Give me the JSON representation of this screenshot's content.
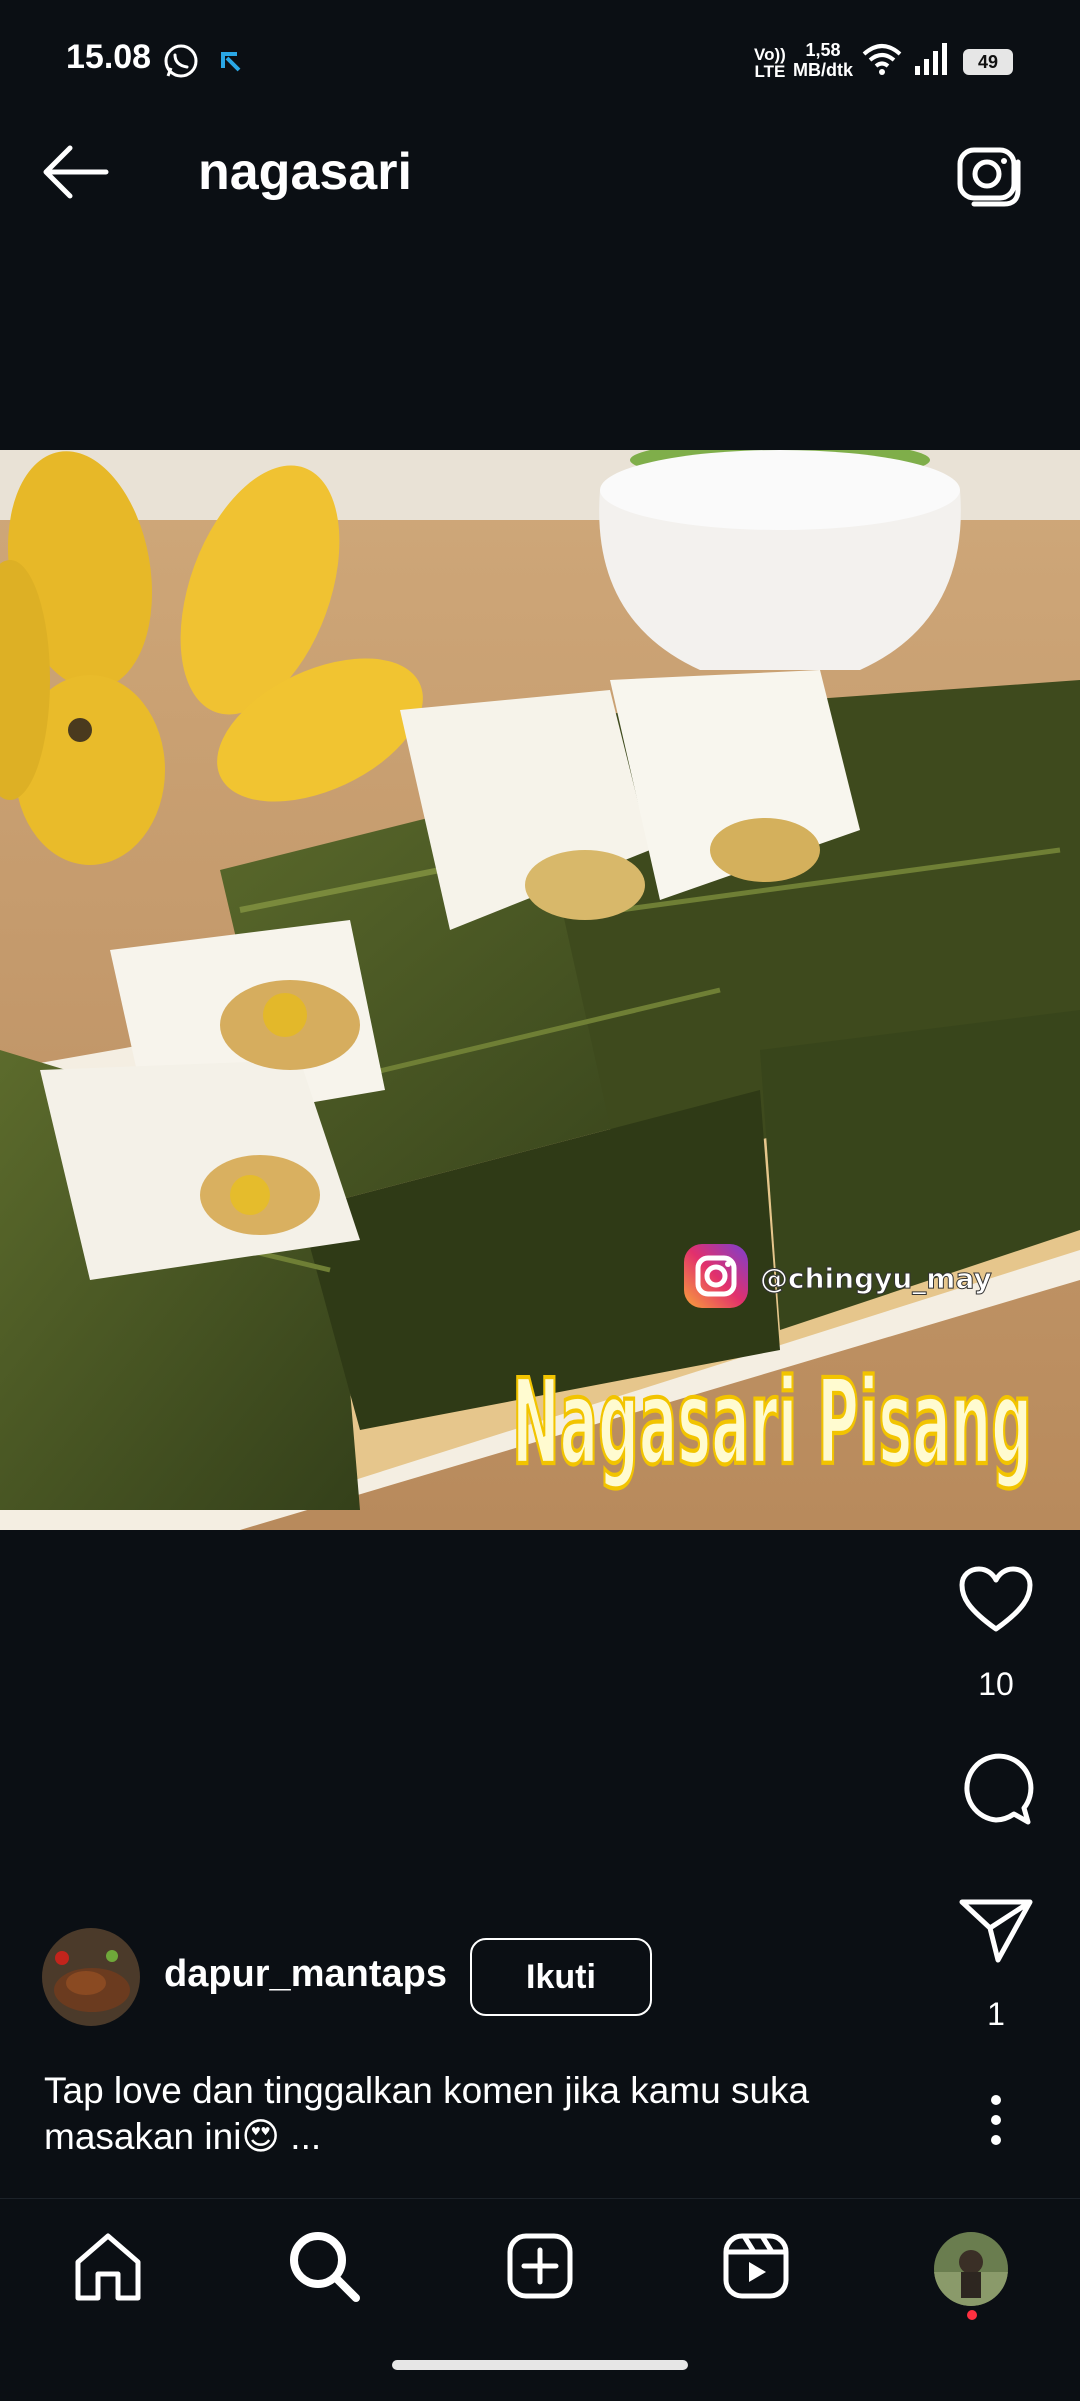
{
  "status_bar": {
    "time": "15.08",
    "volte_top": "Vo))",
    "volte_bottom": "LTE",
    "speed_value": "1,58",
    "speed_unit": "MB/dtk",
    "battery": "49"
  },
  "header": {
    "title": "nagasari"
  },
  "post": {
    "image_watermark_handle": "@chingyu_may",
    "image_overlay_title": "Nagasari Pisang",
    "likes": "10",
    "shares": "1",
    "author": "dapur_mantaps",
    "follow_label": "Ikuti",
    "caption_line1": "Tap love dan tinggalkan komen jika kamu suka",
    "caption_line2": "masakan ini😍",
    "caption_more": "...",
    "colors": {
      "follow_border": "#ffffff",
      "background": "#0b0f14"
    }
  },
  "nav": {
    "icons": [
      "home-icon",
      "search-icon",
      "create-icon",
      "reels-icon",
      "profile-avatar"
    ],
    "notification_dot_color": "#ff3040"
  }
}
